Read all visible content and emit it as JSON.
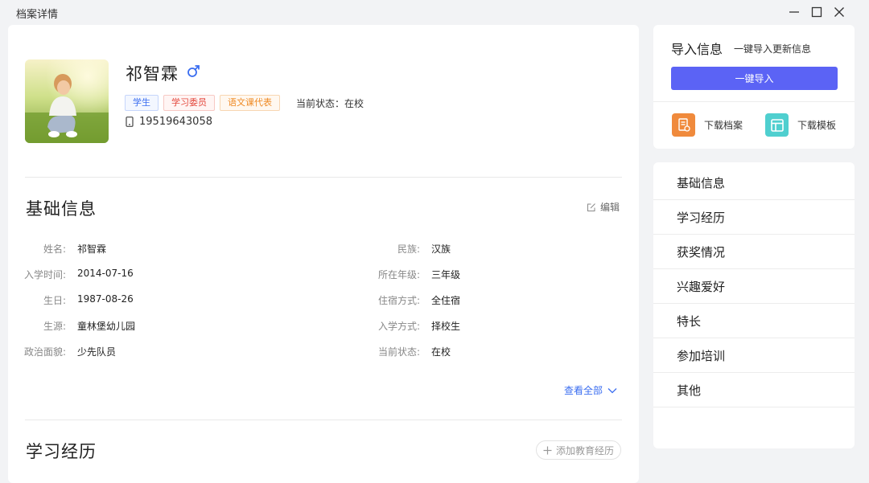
{
  "window": {
    "title": "档案详情"
  },
  "profile": {
    "name": "祁智霖",
    "gender_icon": "male-icon",
    "tags": [
      "学生",
      "学习委员",
      "语文课代表"
    ],
    "status": "当前状态：在校",
    "phone": "19519643058"
  },
  "basic": {
    "title": "基础信息",
    "edit_label": "编辑",
    "left_fields": [
      {
        "label": "姓名:",
        "value": "祁智霖"
      },
      {
        "label": "入学时间:",
        "value": "2014-07-16"
      },
      {
        "label": "生日:",
        "value": "1987-08-26"
      },
      {
        "label": "生源:",
        "value": "童林堡幼儿园"
      },
      {
        "label": "政治面貌:",
        "value": "少先队员"
      }
    ],
    "right_fields": [
      {
        "label": "民族:",
        "value": "汉族"
      },
      {
        "label": "所在年级:",
        "value": "三年级"
      },
      {
        "label": "住宿方式:",
        "value": "全住宿"
      },
      {
        "label": "入学方式:",
        "value": "择校生"
      },
      {
        "label": "当前状态:",
        "value": "在校"
      }
    ],
    "view_all": "查看全部"
  },
  "education": {
    "title": "学习经历",
    "add_label": "添加教育经历"
  },
  "import": {
    "title": "导入信息",
    "subtitle": "一键导入更新信息",
    "button": "一键导入",
    "download_archive": "下载档案",
    "download_template": "下载模板"
  },
  "nav": {
    "items": [
      "基础信息",
      "学习经历",
      "获奖情况",
      "兴趣爱好",
      "特长",
      "参加培训",
      "其他"
    ]
  },
  "colors": {
    "primary": "#5b63f5",
    "link": "#3a6df0",
    "archive_icon": "#f08a3c",
    "template_icon": "#4fcfcf"
  }
}
